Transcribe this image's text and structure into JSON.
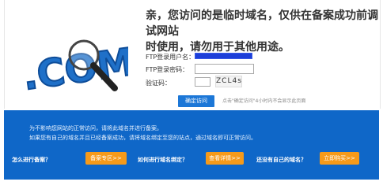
{
  "headline": [
    "亲，您访问的是临时域名，仅供在备案成功前调试网站",
    "时使用，请勿用于其他用途。"
  ],
  "logo": {
    "text": ".COM"
  },
  "form": {
    "ftp_user_label": "FTP登录用户名：",
    "ftp_pass_label": "FTP登录密码：",
    "captcha_label": "验证码：",
    "captcha_text": "ZCL4s"
  },
  "login": {
    "button_label": "确定访问",
    "tip": "点击\"确定访问\"4小时内不会显示此页面"
  },
  "panel": {
    "line1": "为不影响您网站的正常访问，请将此域名并进行备案。",
    "line2": "如果您有自己的域名并且已经备案成功，请将域名绑定至您的站点，通过域名即可正常访问。",
    "q1": "怎么进行备案？",
    "b1": "备案专区>>",
    "q2": "如何进行域名绑定？",
    "b2": "查看详情>>",
    "q3": "还没有自己的域名？",
    "b3": "立即购买>>"
  },
  "colors": {
    "panel": "#0f67c8",
    "button_blue": "#1c77d7",
    "button_orange": "#f59a1a"
  }
}
